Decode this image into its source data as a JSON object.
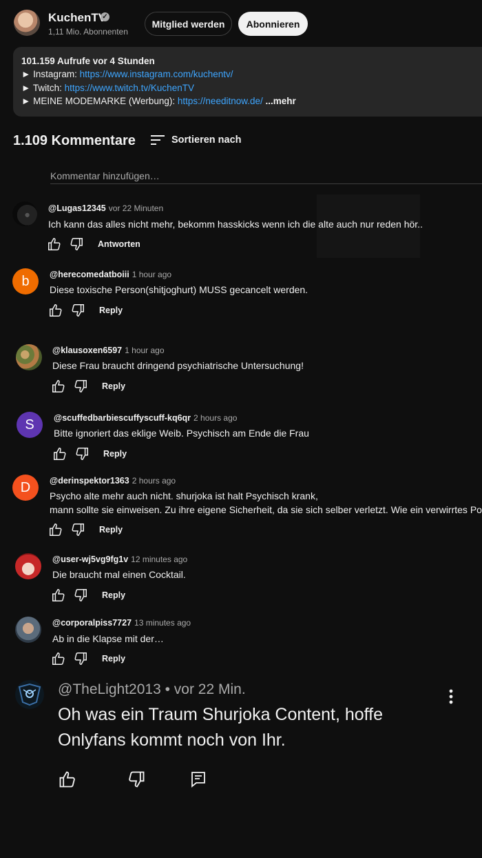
{
  "channel": {
    "name": "KuchenTV",
    "subscribers": "1,11 Mio. Abonnenten",
    "member_button": "Mitglied werden",
    "subscribe_button": "Abonnieren"
  },
  "description": {
    "stats": "101.159 Aufrufe  vor 4 Stunden",
    "instagram_label": "► Instagram: ",
    "instagram_url": "https://www.instagram.com/kuchentv/",
    "twitch_label": "► Twitch: ",
    "twitch_url": "https://www.twitch.tv/KuchenTV",
    "merch_label": "► MEINE MODEMARKE (Werbung): ",
    "merch_url": "https://needitnow.de/",
    "more": "...mehr"
  },
  "comments_header": {
    "count": "1.109 Kommentare",
    "sort_label": "Sortieren nach",
    "add_placeholder": "Kommentar hinzufügen…"
  },
  "comments": [
    {
      "user": "@Lugas12345",
      "time": "vor 22 Minuten",
      "text": "Ich kann das alles nicht mehr, bekomm hasskicks wenn ich die alte auch nur reden hör..",
      "reply": "Antworten"
    },
    {
      "user": "@herecomedatboiii",
      "time": "1 hour ago",
      "text": "Diese toxische Person(shitjoghurt) MUSS gecancelt werden.",
      "reply": "Reply",
      "avatar_letter": "b",
      "avatar_color": "#ef6c00"
    },
    {
      "user": "@klausoxen6597",
      "time": "1 hour ago",
      "text": "Diese Frau braucht dringend psychiatrische Untersuchung!",
      "reply": "Reply"
    },
    {
      "user": "@scuffedbarbiescuffyscuff-kq6qr",
      "time": "2 hours ago",
      "text": "Bitte ignoriert das eklige Weib. Psychisch am Ende die Frau",
      "reply": "Reply",
      "avatar_letter": "S",
      "avatar_color": "#5e35b1"
    },
    {
      "user": "@derinspektor1363",
      "time": "2 hours ago",
      "text": "Psycho alte mehr auch nicht. shurjoka ist halt Psychisch krank,",
      "text2": "mann sollte sie einweisen. Zu ihre eigene Sicherheit, da sie sich selber verletzt. Wie ein verwirrtes Pokémon",
      "reply": "Reply",
      "avatar_letter": "D",
      "avatar_color": "#f4511e"
    },
    {
      "user": "@user-wj5vg9fg1v",
      "time": "12 minutes ago",
      "text": "Die braucht mal einen Cocktail.",
      "reply": "Reply"
    },
    {
      "user": "@corporalpiss7727",
      "time": "13 minutes ago",
      "text": "Ab in die Klapse mit der…",
      "reply": "Reply"
    },
    {
      "user": "@TheLight2013 • vor 22 Min.",
      "text": "Oh was ein Traum Shurjoka Content, hoffe Onlyfans kommt noch von Ihr."
    }
  ]
}
